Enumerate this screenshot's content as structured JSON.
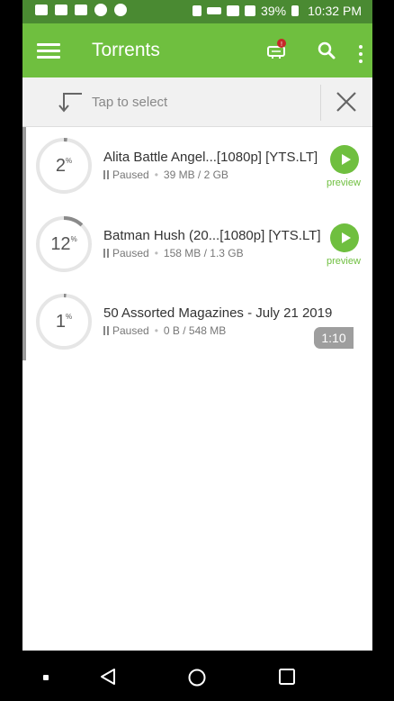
{
  "statusbar": {
    "battery": "39%",
    "time": "10:32 PM"
  },
  "appbar": {
    "title": "Torrents"
  },
  "selectbar": {
    "label": "Tap to select"
  },
  "torrents": [
    {
      "name": "Alita Battle Angel...[1080p] [YTS.LT]",
      "progress": 2,
      "percent_sign": "%",
      "status": "Paused",
      "size": "39 MB / 2 GB",
      "preview_label": "preview"
    },
    {
      "name": "Batman Hush (20...[1080p] [YTS.LT]",
      "progress": 12,
      "percent_sign": "%",
      "status": "Paused",
      "size": "158 MB / 1.3 GB",
      "preview_label": "preview"
    },
    {
      "name": "50 Assorted Magazines - July 21 2019",
      "progress": 1,
      "percent_sign": "%",
      "status": "Paused",
      "size": "0 B / 548 MB"
    }
  ],
  "time_badge": "1:10",
  "colors": {
    "accent": "#6fbf3f",
    "statusbar": "#4a8a32",
    "ring_track": "#e6e6e6",
    "ring_fill": "#8a8a8a"
  }
}
